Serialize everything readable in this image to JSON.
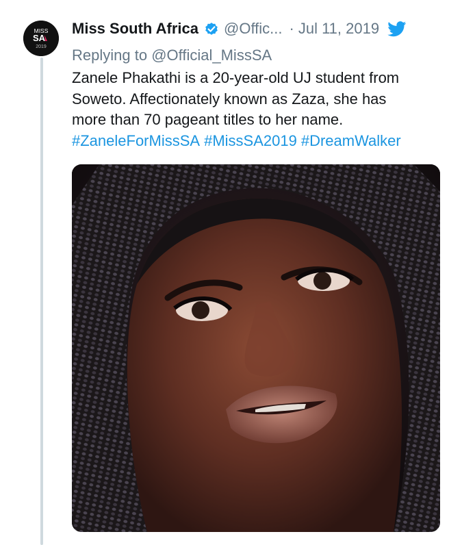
{
  "tweet": {
    "avatar_text": {
      "line1": "MISS",
      "line2": "SA",
      "line3": "2019"
    },
    "author_name": "Miss South Africa",
    "author_handle": "@Offic...",
    "separator": "·",
    "date": "Jul 11, 2019",
    "replying_prefix": "Replying to",
    "replying_to": "@Official_MissSA",
    "body_line1": "Zanele Phakathi is a 20-year-old UJ student from",
    "body_line2": "Soweto. Affectionately known as Zaza, she has",
    "body_line3": "more than 70 pageant titles to her name.",
    "hashtags": [
      "#ZaneleForMissSA",
      "#MissSA2019",
      "#DreamWalker"
    ]
  },
  "icons": {
    "verified": "verified-badge-icon",
    "platform": "twitter-bird-icon"
  },
  "colors": {
    "link": "#1b95e0",
    "secondary_text": "#657786",
    "primary_text": "#14171a",
    "thread_line": "#cfd9de",
    "verified_badge": "#1da1f2"
  }
}
